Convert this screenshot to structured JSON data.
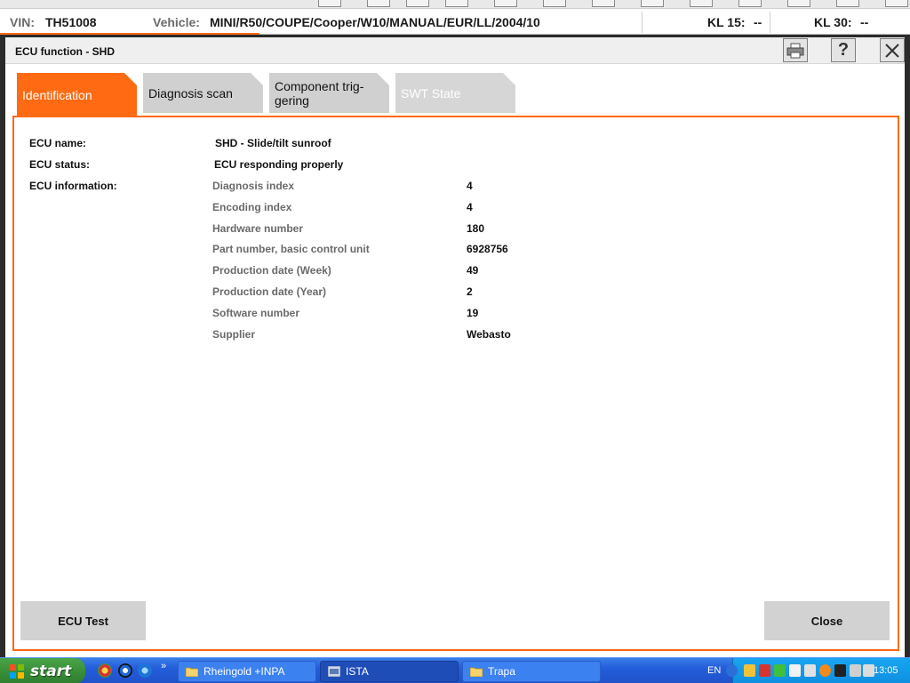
{
  "vehicle_bar": {
    "vin_label": "VIN:",
    "vin_value": "TH51008",
    "vehicle_label": "Vehicle:",
    "vehicle_value": "MINI/R50/COUPE/Cooper/W10/MANUAL/EUR/LL/2004/10",
    "kl15_label": "KL 15:",
    "kl15_value": "--",
    "kl30_label": "KL 30:",
    "kl30_value": "--"
  },
  "dialog": {
    "title": "ECU function - SHD",
    "buttons": {
      "print_icon": "printer-icon",
      "help_label": "?",
      "close_icon": "close-icon"
    }
  },
  "tabs": [
    {
      "label": "Identification",
      "state": "active"
    },
    {
      "label": "Diagnosis scan",
      "state": "normal"
    },
    {
      "label_line1": "Component trig-",
      "label_line2": "gering",
      "state": "normal"
    },
    {
      "label": "SWT State",
      "state": "disabled"
    }
  ],
  "ecu": {
    "name_label": "ECU name:",
    "name_value": "SHD - Slide/tilt sunroof",
    "status_label": "ECU status:",
    "status_value": "ECU responding properly",
    "info_label": "ECU information:",
    "info_rows": [
      {
        "label": "Diagnosis index",
        "value": "4"
      },
      {
        "label": "Encoding index",
        "value": "4"
      },
      {
        "label": "Hardware number",
        "value": "180"
      },
      {
        "label": "Part number, basic control unit",
        "value": "6928756"
      },
      {
        "label": "Production date (Week)",
        "value": "49"
      },
      {
        "label": "Production date (Year)",
        "value": "2"
      },
      {
        "label": "Software number",
        "value": "19"
      },
      {
        "label": "Supplier",
        "value": "Webasto"
      }
    ]
  },
  "actions": {
    "ecu_test_label": "ECU Test",
    "close_label": "Close"
  },
  "taskbar": {
    "start_label": "start",
    "tasks": [
      {
        "label": "Rheingold +INPA",
        "icon": "folder-icon"
      },
      {
        "label": "ISTA",
        "icon": "app-icon"
      },
      {
        "label": "Trapa",
        "icon": "folder-icon"
      }
    ],
    "language": "EN",
    "clock": "13:05"
  },
  "colors": {
    "accent": "#ff6a13",
    "tab_inactive": "#d0d0d0",
    "button_gray": "#d2d2d2"
  }
}
